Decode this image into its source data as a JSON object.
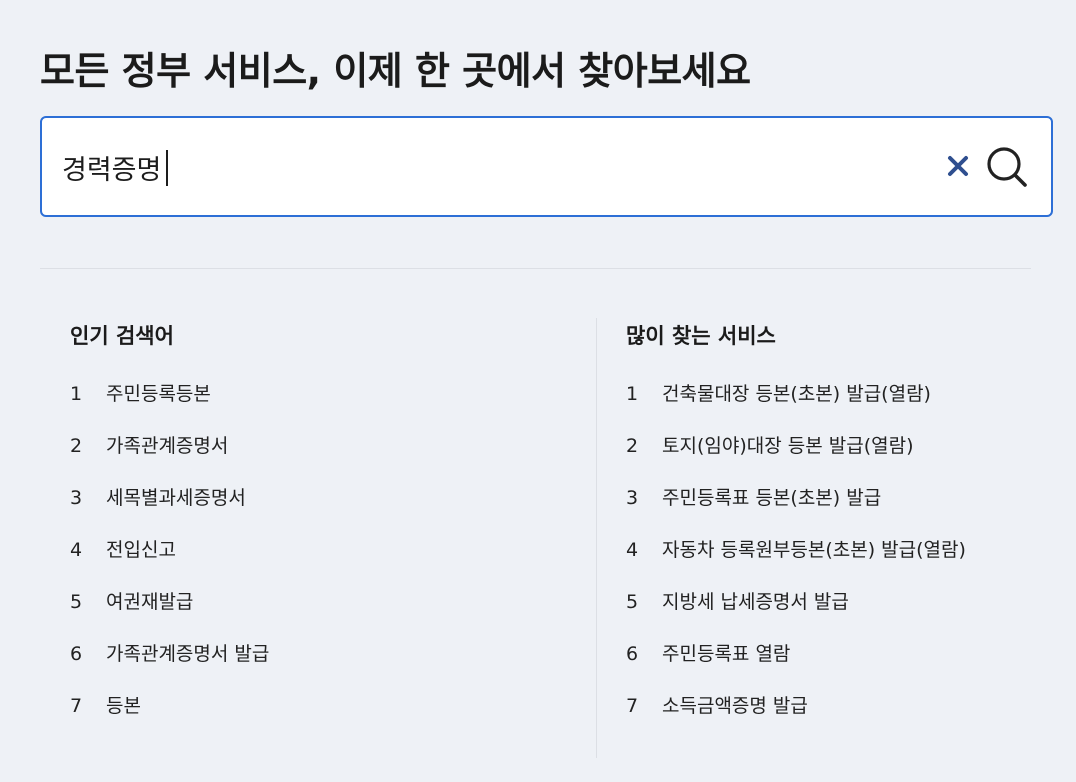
{
  "title": "모든 정부 서비스, 이제 한 곳에서 찾아보세요",
  "search": {
    "value": "경력증명",
    "placeholder": ""
  },
  "popular": {
    "title": "인기 검색어",
    "items": [
      {
        "rank": "1",
        "label": "주민등록등본"
      },
      {
        "rank": "2",
        "label": "가족관계증명서"
      },
      {
        "rank": "3",
        "label": "세목별과세증명서"
      },
      {
        "rank": "4",
        "label": "전입신고"
      },
      {
        "rank": "5",
        "label": "여권재발급"
      },
      {
        "rank": "6",
        "label": "가족관계증명서 발급"
      },
      {
        "rank": "7",
        "label": "등본"
      }
    ]
  },
  "frequent": {
    "title": "많이 찾는 서비스",
    "items": [
      {
        "rank": "1",
        "label": "건축물대장 등본(초본) 발급(열람)"
      },
      {
        "rank": "2",
        "label": "토지(임야)대장 등본 발급(열람)"
      },
      {
        "rank": "3",
        "label": "주민등록표 등본(초본) 발급"
      },
      {
        "rank": "4",
        "label": "자동차 등록원부등본(초본) 발급(열람)"
      },
      {
        "rank": "5",
        "label": "지방세 납세증명서 발급"
      },
      {
        "rank": "6",
        "label": "주민등록표 열람"
      },
      {
        "rank": "7",
        "label": "소득금액증명 발급"
      }
    ]
  },
  "icons": {
    "clear": "close-icon",
    "search": "search-icon"
  },
  "colors": {
    "accent": "#2d6fd6",
    "clear_icon": "#2f4f8f",
    "background": "#eef1f6"
  }
}
